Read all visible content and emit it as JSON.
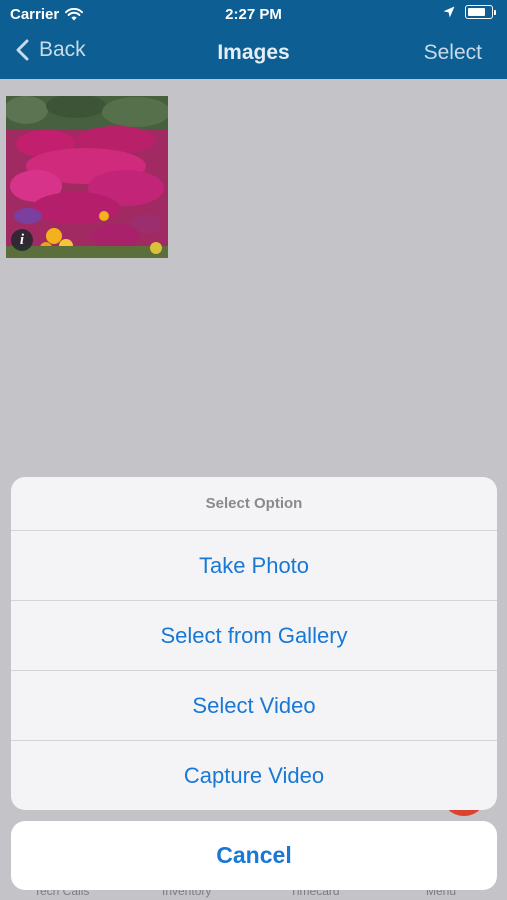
{
  "status_bar": {
    "carrier": "Carrier",
    "time": "2:27 PM",
    "icons": [
      "wifi-icon",
      "location-arrow-icon",
      "battery-icon"
    ]
  },
  "nav": {
    "back_label": "Back",
    "title": "Images",
    "select_label": "Select"
  },
  "gallery": {
    "items": [
      {
        "info_label": "i"
      }
    ]
  },
  "action_sheet": {
    "title": "Select Option",
    "options": [
      "Take Photo",
      "Select from Gallery",
      "Select Video",
      "Capture Video"
    ],
    "cancel_label": "Cancel"
  },
  "tab_bar": {
    "tabs": [
      "Tech Calls",
      "Inventory",
      "Timecard",
      "Menu"
    ]
  },
  "colors": {
    "header": "#0c5e93",
    "accent": "#1878d6",
    "overlay": "#c4c3c8",
    "fab": "#d9432f"
  }
}
